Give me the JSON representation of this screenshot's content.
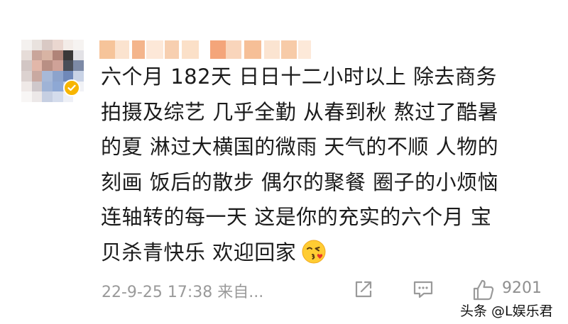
{
  "comment": {
    "lines": [
      "六个月 182天 日日十二小时以上 除去商务",
      "拍摄及综艺 几乎全勤 从春到秋 熬过了酷暑",
      "的夏 淋过大横国的微雨 天气的不顺 人物的",
      "刻画 饭后的散步 偶尔的聚餐 圈子的小烦恼",
      "连轴转的每一天 这是你的充实的六个月 宝",
      "贝杀青快乐 欢迎回家"
    ],
    "emoji": "kissing-face-emoji"
  },
  "meta": {
    "timestamp": "22-9-25 17:38 来自..."
  },
  "actions": {
    "share_icon": "share-icon",
    "comment_icon": "comment-icon",
    "like_icon": "thumbs-up-icon",
    "like_count": "9201"
  },
  "watermark": {
    "text": "头条 @L娱乐君"
  },
  "colors": {
    "text": "#1b1b1b",
    "meta": "#9a9a9a",
    "verified_badge": "#f7b500"
  }
}
